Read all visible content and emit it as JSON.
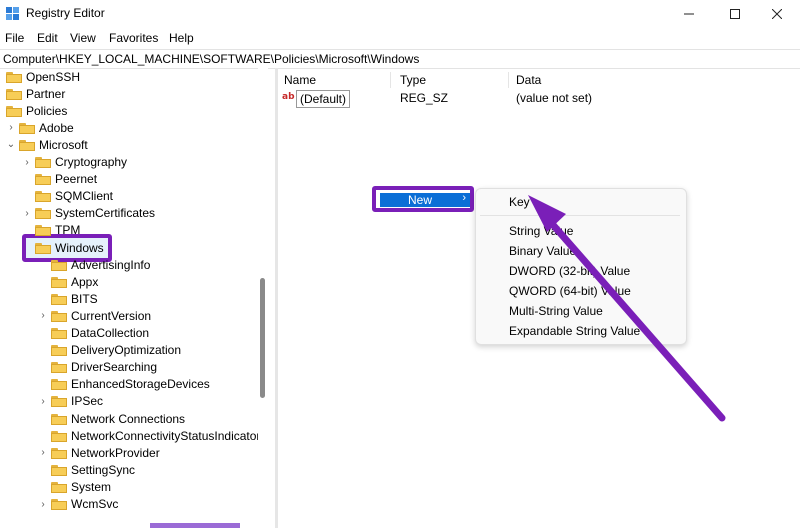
{
  "window": {
    "title": "Registry Editor",
    "controls": [
      "minimize",
      "maximize",
      "close"
    ]
  },
  "menu": [
    "File",
    "Edit",
    "View",
    "Favorites",
    "Help"
  ],
  "address": "Computer\\HKEY_LOCAL_MACHINE\\SOFTWARE\\Policies\\Microsoft\\Windows",
  "tree": [
    {
      "label": "OpenSSH",
      "chevron": ""
    },
    {
      "label": "Partner",
      "chevron": ""
    },
    {
      "label": "Policies",
      "chevron": ""
    },
    {
      "label": "Adobe",
      "chevron": ">"
    },
    {
      "label": "Microsoft",
      "chevron": "v"
    },
    {
      "label": "Cryptography",
      "chevron": ">"
    },
    {
      "label": "Peernet",
      "chevron": ""
    },
    {
      "label": "SQMClient",
      "chevron": ""
    },
    {
      "label": "SystemCertificates",
      "chevron": ">"
    },
    {
      "label": "TPM",
      "chevron": ""
    },
    {
      "label": "Windows",
      "chevron": ""
    },
    {
      "label": "AdvertisingInfo",
      "chevron": ""
    },
    {
      "label": "Appx",
      "chevron": ""
    },
    {
      "label": "BITS",
      "chevron": ""
    },
    {
      "label": "CurrentVersion",
      "chevron": ">"
    },
    {
      "label": "DataCollection",
      "chevron": ""
    },
    {
      "label": "DeliveryOptimization",
      "chevron": ""
    },
    {
      "label": "DriverSearching",
      "chevron": ""
    },
    {
      "label": "EnhancedStorageDevices",
      "chevron": ""
    },
    {
      "label": "IPSec",
      "chevron": ">"
    },
    {
      "label": "Network Connections",
      "chevron": ""
    },
    {
      "label": "NetworkConnectivityStatusIndicator",
      "chevron": ""
    },
    {
      "label": "NetworkProvider",
      "chevron": ">"
    },
    {
      "label": "SettingSync",
      "chevron": ""
    },
    {
      "label": "System",
      "chevron": ""
    },
    {
      "label": "WcmSvc",
      "chevron": ">"
    }
  ],
  "list": {
    "columns": [
      "Name",
      "Type",
      "Data"
    ],
    "rows": [
      {
        "name": "(Default)",
        "type": "REG_SZ",
        "data": "(value not set)"
      }
    ]
  },
  "context_menu": {
    "new_label": "New",
    "arrow": "›"
  },
  "submenu": [
    "Key",
    "String Value",
    "Binary Value",
    "DWORD (32-bit) Value",
    "QWORD (64-bit) Value",
    "Multi-String Value",
    "Expandable String Value"
  ],
  "colors": {
    "highlight": "#0b6fd6",
    "annotation": "#7a1fb8",
    "folder": "#f7cd57"
  }
}
